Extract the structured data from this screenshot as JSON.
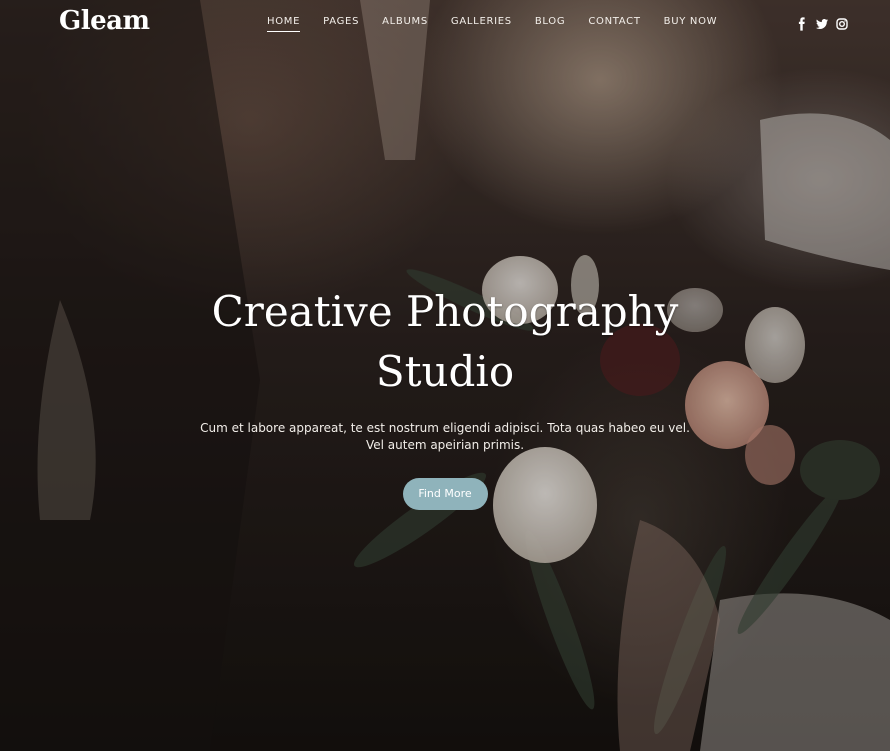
{
  "brand": {
    "logo": "Gleam"
  },
  "nav": {
    "items": [
      {
        "label": "HOME",
        "active": true
      },
      {
        "label": "PAGES"
      },
      {
        "label": "ALBUMS"
      },
      {
        "label": "GALLERIES"
      },
      {
        "label": "BLOG"
      },
      {
        "label": "CONTACT"
      },
      {
        "label": "BUY NOW"
      }
    ]
  },
  "social": [
    "facebook-icon",
    "twitter-icon",
    "instagram-icon"
  ],
  "hero": {
    "title_line1": "Creative Photography",
    "title_line2": "Studio",
    "text": "Cum et labore appareat, te est nostrum eligendi adipisci. Tota quas habeo eu vel. Vel autem apeirian primis.",
    "button_label": "Find More"
  },
  "colors": {
    "accent": "#8fb3bb",
    "text": "#ffffff"
  }
}
